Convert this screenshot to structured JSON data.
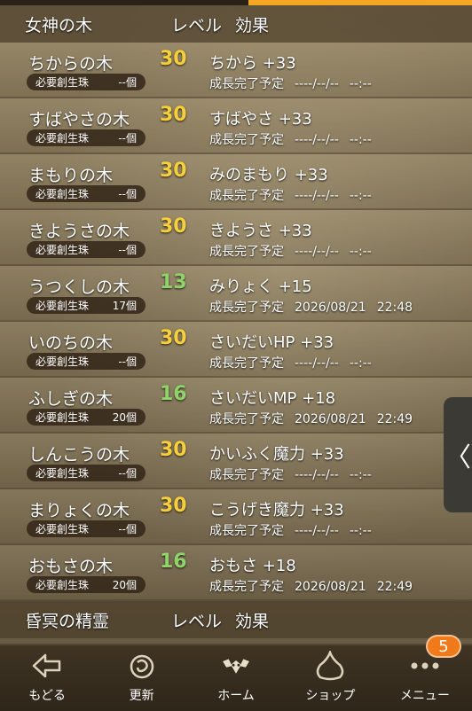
{
  "section1": {
    "name_header": "女神の木",
    "level_header": "レベル",
    "effect_header": "効果"
  },
  "pill_label": "必要創生珠",
  "eta_label": "成長完了予定",
  "trees": [
    {
      "name": "ちからの木",
      "level": "30",
      "level_style": "max",
      "orbs": "--個",
      "effect": "ちから +33",
      "date": "----/--/--",
      "time": "--:--"
    },
    {
      "name": "すばやさの木",
      "level": "30",
      "level_style": "max",
      "orbs": "--個",
      "effect": "すばやさ +33",
      "date": "----/--/--",
      "time": "--:--"
    },
    {
      "name": "まもりの木",
      "level": "30",
      "level_style": "max",
      "orbs": "--個",
      "effect": "みのまもり +33",
      "date": "----/--/--",
      "time": "--:--"
    },
    {
      "name": "きようさの木",
      "level": "30",
      "level_style": "max",
      "orbs": "--個",
      "effect": "きようさ +33",
      "date": "----/--/--",
      "time": "--:--"
    },
    {
      "name": "うつくしの木",
      "level": "13",
      "level_style": "mid",
      "orbs": "17個",
      "effect": "みりょく +15",
      "date": "2026/08/21",
      "time": "22:48"
    },
    {
      "name": "いのちの木",
      "level": "30",
      "level_style": "max",
      "orbs": "--個",
      "effect": "さいだいHP +33",
      "date": "----/--/--",
      "time": "--:--"
    },
    {
      "name": "ふしぎの木",
      "level": "16",
      "level_style": "mid",
      "orbs": "20個",
      "effect": "さいだいMP +18",
      "date": "2026/08/21",
      "time": "22:49"
    },
    {
      "name": "しんこうの木",
      "level": "30",
      "level_style": "max",
      "orbs": "--個",
      "effect": "かいふく魔力 +33",
      "date": "----/--/--",
      "time": "--:--"
    },
    {
      "name": "まりょくの木",
      "level": "30",
      "level_style": "max",
      "orbs": "--個",
      "effect": "こうげき魔力 +33",
      "date": "----/--/--",
      "time": "--:--"
    },
    {
      "name": "おもさの木",
      "level": "16",
      "level_style": "mid",
      "orbs": "20個",
      "effect": "おもさ +18",
      "date": "2026/08/21",
      "time": "22:49"
    }
  ],
  "section2": {
    "name_header": "昏冥の精霊",
    "level_header": "レベル",
    "effect_header": "効果"
  },
  "side_handle": {
    "glyph": "〈",
    "icon": "chevron-left-icon"
  },
  "nav": {
    "back_label": "もどる",
    "refresh_label": "更新",
    "home_label": "ホーム",
    "shop_label": "ショップ",
    "menu_label": "メニュー",
    "menu_badge": "5"
  },
  "colors": {
    "accent": "#f5a623",
    "level_max": "#f6cf3a",
    "level_mid": "#8fd36a",
    "badge": "#f07a1a"
  }
}
